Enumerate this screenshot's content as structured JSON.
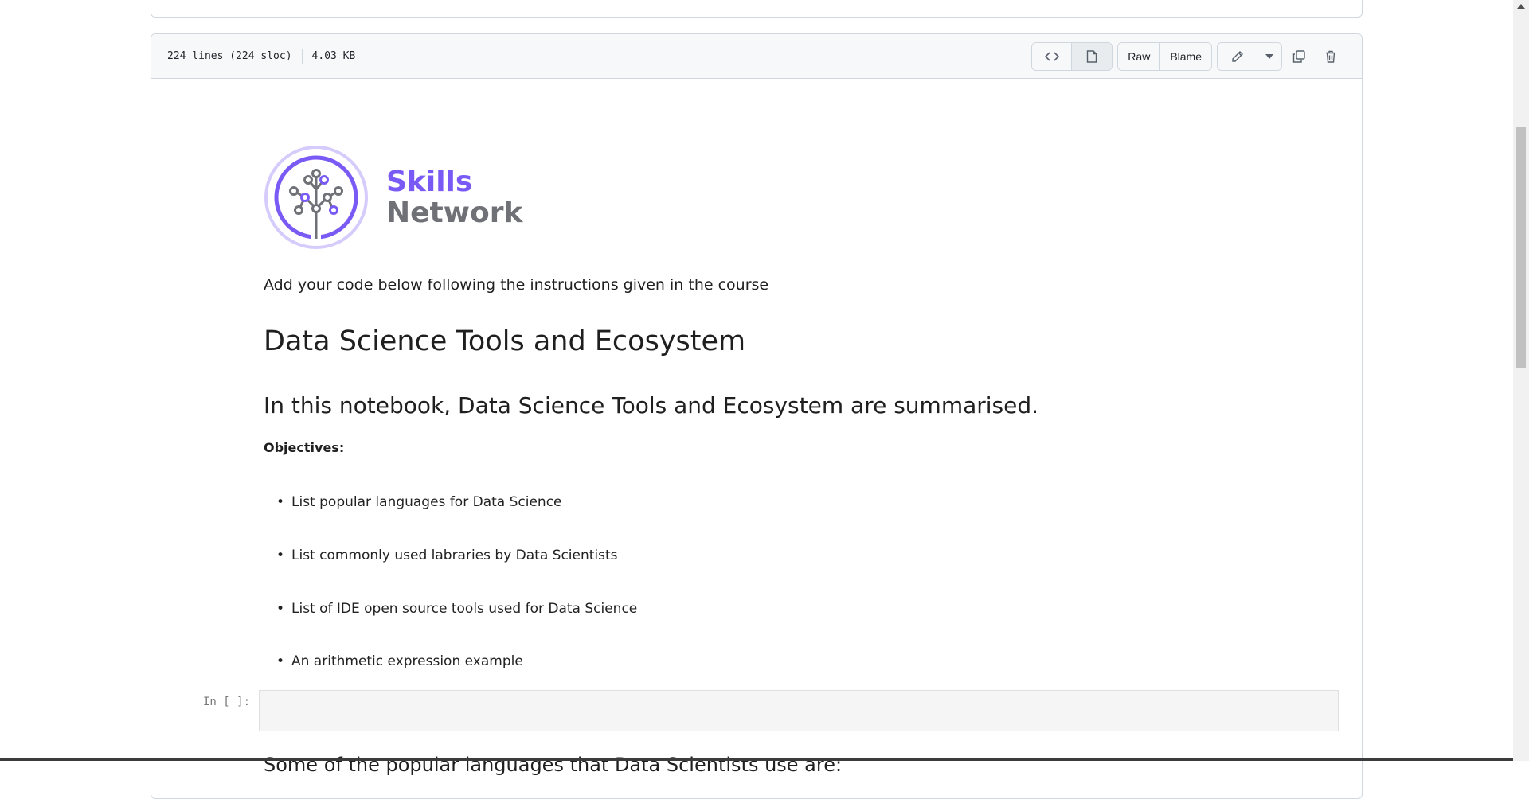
{
  "file_header": {
    "lines": "224 lines (224 sloc)",
    "size": "4.03 KB",
    "raw_label": "Raw",
    "blame_label": "Blame"
  },
  "logo": {
    "line1": "Skills",
    "line2": "Network"
  },
  "notebook": {
    "intro": "Add your code below following the instructions given in the course",
    "title": "Data Science Tools and Ecosystem",
    "subtitle": "In this notebook, Data Science Tools and Ecosystem are summarised.",
    "objectives_label": "Objectives:",
    "objectives": [
      "List popular languages for Data Science",
      "List commonly used labraries by Data Scientists",
      "List of IDE open source tools used for Data Science",
      "An arithmetic expression example"
    ],
    "cell_prompt": "In [ ]:",
    "section_heading": "Some of the popular languages that Data Scientists use are:"
  },
  "colors": {
    "brand_purple": "#7a5af5",
    "brand_gray": "#6f7177"
  },
  "icons": [
    "code-icon",
    "file-icon",
    "pencil-icon",
    "chevron-down-icon",
    "copy-icon",
    "trash-icon"
  ]
}
